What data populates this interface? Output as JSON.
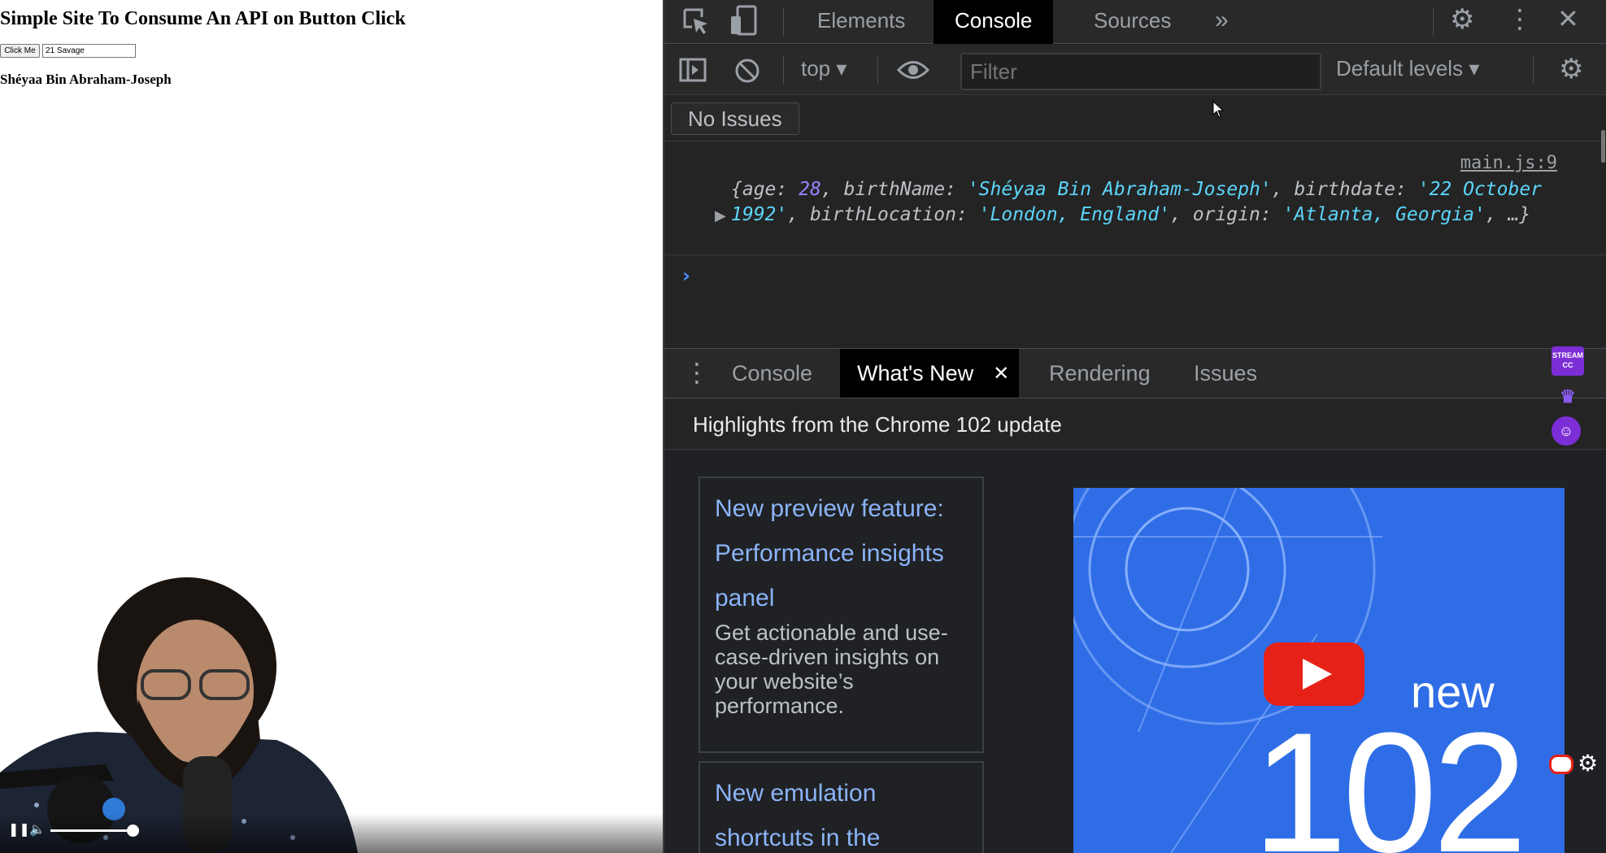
{
  "page": {
    "heading": "Simple Site To Consume An API on Button Click",
    "button_label": "Click Me",
    "input_value": "21 Savage",
    "result_name": "Shéyaa Bin Abraham-Joseph"
  },
  "devtools": {
    "tabs": [
      "Elements",
      "Console",
      "Sources"
    ],
    "active_tab": "Console",
    "more_tabs_glyph": "»",
    "console": {
      "context": "top",
      "filter_placeholder": "Filter",
      "levels": "Default levels",
      "issues": "No Issues",
      "log": {
        "source": "main.js:9",
        "open": "{",
        "k_age": "age: ",
        "v_age": "28",
        "k_birthName": ", birthName: ",
        "v_birthName": "'Shéyaa Bin Abraham-Joseph'",
        "k_birthdate": ", birthdate: ",
        "v_birthdate": "'22 October 1992'",
        "k_birthLocation": ", birthLocation: ",
        "v_birthLocation": "'London, England'",
        "k_origin": ", origin: ",
        "v_origin": "'Atlanta, Georgia'",
        "close": ", …}"
      },
      "prompt": "›"
    },
    "drawer": {
      "tabs": [
        "Console",
        "What's New",
        "Rendering",
        "Issues"
      ],
      "active_tab": "What's New",
      "close_glyph": "✕",
      "header": "Highlights from the Chrome 102 update",
      "features": [
        {
          "title": "New preview feature: Performance insights panel",
          "description": "Get actionable and use-case-driven insights on your website’s performance."
        },
        {
          "title": "New emulation shortcuts in the",
          "description": ""
        }
      ],
      "video": {
        "label_new": "new",
        "label_version": "102"
      }
    }
  },
  "overlay": {
    "stream_cc": "STREAM CC"
  },
  "colors": {
    "accent": "#4b8bff",
    "link": "#8ab4f8",
    "string": "#5cd5fb",
    "number": "#9980ff",
    "video_bg": "#2f6de7",
    "youtube_red": "#e62117"
  },
  "icons": [
    "inspect-icon",
    "device-toolbar-icon",
    "settings-icon",
    "more-icon",
    "close-icon",
    "sidebar-icon",
    "clear-console-icon",
    "eye-icon",
    "play-icon",
    "pause-icon",
    "volume-icon",
    "fullscreen-icon"
  ]
}
